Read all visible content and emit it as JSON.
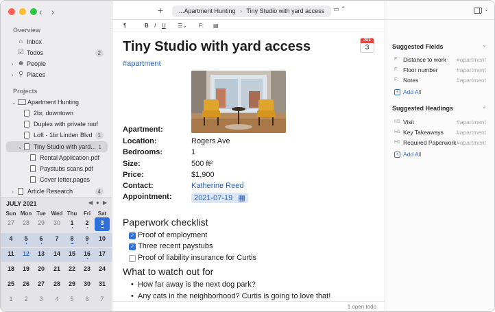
{
  "toolbar": {
    "breadcrumb_parent": "...Apartment Hunting",
    "breadcrumb_sep": "›",
    "breadcrumb_current": "Tiny Studio with yard access"
  },
  "format_bar": {
    "paragraph": "¶",
    "bold": "B",
    "italic": "I",
    "underline": "U",
    "field": "F:"
  },
  "sidebar": {
    "overview_title": "Overview",
    "overview": [
      {
        "label": "Inbox",
        "icon": "tray-icon"
      },
      {
        "label": "Todos",
        "icon": "checkbox-icon",
        "badge": "2"
      },
      {
        "label": "People",
        "icon": "people-icon"
      },
      {
        "label": "Places",
        "icon": "location-icon"
      }
    ],
    "projects_title": "Projects",
    "projects": [
      {
        "label": "Apartment Hunting",
        "type": "folder"
      },
      {
        "label": "2br, downtown",
        "type": "doc"
      },
      {
        "label": "Duplex with private roof",
        "type": "doc"
      },
      {
        "label": "Loft - 1br Linden Blvd",
        "type": "doc",
        "badge": "1"
      },
      {
        "label": "Tiny Studio with yard...",
        "type": "doc",
        "badge": "1",
        "selected": true
      },
      {
        "label": "Rental Application.pdf",
        "type": "file"
      },
      {
        "label": "Paystubs scans.pdf",
        "type": "file"
      },
      {
        "label": "Cover letter.pages",
        "type": "file"
      },
      {
        "label": "Article Research",
        "type": "doc",
        "badge": "4"
      }
    ]
  },
  "calendar": {
    "month": "JULY 2021",
    "nav": [
      "◀",
      "●",
      "▶"
    ],
    "dow": [
      "Sun",
      "Mon",
      "Tue",
      "Wed",
      "Thu",
      "Fri",
      "Sat"
    ],
    "weeks": [
      [
        {
          "d": "27",
          "m": true
        },
        {
          "d": "28",
          "m": true
        },
        {
          "d": "29",
          "m": true
        },
        {
          "d": "30",
          "m": true
        },
        {
          "d": "1",
          "dots": "•"
        },
        {
          "d": "2",
          "dots": "•"
        },
        {
          "d": "3",
          "today": true,
          "dots": "•••"
        }
      ],
      [
        {
          "d": "4"
        },
        {
          "d": "5",
          "dots": "•"
        },
        {
          "d": "6",
          "dots": "•"
        },
        {
          "d": "7"
        },
        {
          "d": "8",
          "dots": "•••"
        },
        {
          "d": "9",
          "dots": "•"
        },
        {
          "d": "10"
        }
      ],
      [
        {
          "d": "11"
        },
        {
          "d": "12",
          "blue": true
        },
        {
          "d": "13"
        },
        {
          "d": "14"
        },
        {
          "d": "15"
        },
        {
          "d": "16",
          "dots": "•"
        },
        {
          "d": "17"
        }
      ],
      [
        {
          "d": "18"
        },
        {
          "d": "19"
        },
        {
          "d": "20"
        },
        {
          "d": "21"
        },
        {
          "d": "22"
        },
        {
          "d": "23"
        },
        {
          "d": "24"
        }
      ],
      [
        {
          "d": "25"
        },
        {
          "d": "26"
        },
        {
          "d": "27"
        },
        {
          "d": "28"
        },
        {
          "d": "29"
        },
        {
          "d": "30"
        },
        {
          "d": "31"
        }
      ],
      [
        {
          "d": "1",
          "m": true
        },
        {
          "d": "2",
          "m": true
        },
        {
          "d": "3",
          "m": true
        },
        {
          "d": "4",
          "m": true
        },
        {
          "d": "5",
          "m": true
        },
        {
          "d": "6",
          "m": true
        },
        {
          "d": "7",
          "m": true
        }
      ]
    ]
  },
  "note": {
    "title": "Tiny Studio with yard access",
    "tag": "#apartment",
    "cal_month": "JUL",
    "cal_day": "3",
    "props": [
      {
        "k": "Apartment:",
        "v": ""
      },
      {
        "k": "Location:",
        "v": "Rogers Ave"
      },
      {
        "k": "Bedrooms:",
        "v": "1"
      },
      {
        "k": "Size:",
        "v": "500 ft²"
      },
      {
        "k": "Price:",
        "v": "$1,900"
      },
      {
        "k": "Contact:",
        "v": "Katherine Reed",
        "link": true
      },
      {
        "k": "Appointment:",
        "v": "2021-07-19",
        "date": true
      }
    ],
    "checklist_title": "Paperwork checklist",
    "checklist": [
      {
        "t": "Proof of employment",
        "done": true
      },
      {
        "t": "Three recent paystubs",
        "done": true
      },
      {
        "t": "Proof of liability insurance for Curtis",
        "done": false
      }
    ],
    "watch_title": "What to watch out for",
    "watch": [
      "How far away is the next dog park?",
      "Any cats in the neighborhood? Curtis is going to love that!"
    ],
    "status": "1 open todo"
  },
  "right_panel": {
    "fields_title": "Suggested Fields",
    "fields": [
      {
        "icon": "F:",
        "name": "Distance to work",
        "hint": "#apartment"
      },
      {
        "icon": "F:",
        "name": "Floor number",
        "hint": "#apartment"
      },
      {
        "icon": "F:",
        "name": "Notes",
        "hint": "#apartment"
      }
    ],
    "fields_add": "Add All",
    "headings_title": "Suggested Headings",
    "headings": [
      {
        "icon": "H1",
        "name": "Visit",
        "hint": "#apartment"
      },
      {
        "icon": "H1",
        "name": "Key Takeaways",
        "hint": "#apartment"
      },
      {
        "icon": "H1",
        "name": "Required Paperwork",
        "hint": "#apartment"
      }
    ],
    "headings_add": "Add All"
  }
}
